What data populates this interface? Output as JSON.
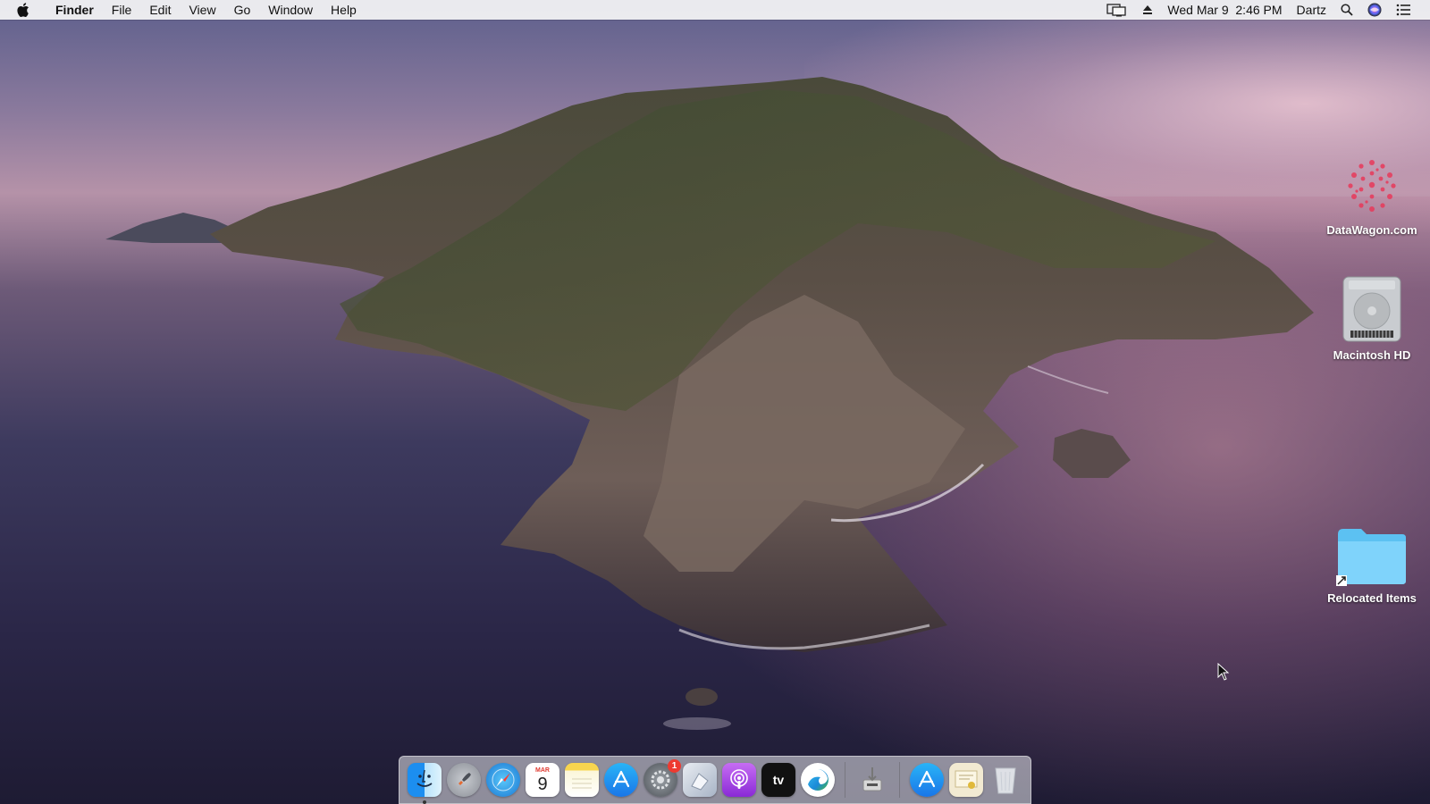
{
  "menubar": {
    "app_name": "Finder",
    "menus": [
      "File",
      "Edit",
      "View",
      "Go",
      "Window",
      "Help"
    ],
    "datetime": "Wed Mar 9  2:46 PM",
    "user": "Dartz",
    "status_icons": [
      "display-mirroring-icon",
      "eject-icon",
      "spotlight-icon",
      "siri-icon",
      "notification-center-icon"
    ]
  },
  "desktop": {
    "icons": [
      {
        "label": "DataWagon.com",
        "icon": "datawagon-logo-icon"
      },
      {
        "label": "Macintosh HD",
        "icon": "hard-drive-icon"
      },
      {
        "label": "Relocated Items",
        "icon": "folder-alias-icon"
      }
    ]
  },
  "dock": {
    "apps": [
      {
        "name": "finder-icon",
        "running": true
      },
      {
        "name": "launchpad-icon"
      },
      {
        "name": "safari-icon"
      },
      {
        "name": "calendar-icon",
        "month": "MAR",
        "day": "9"
      },
      {
        "name": "notes-icon"
      },
      {
        "name": "app-store-icon"
      },
      {
        "name": "system-preferences-icon",
        "badge": "1"
      },
      {
        "name": "preview-icon"
      },
      {
        "name": "podcasts-icon"
      },
      {
        "name": "apple-tv-icon",
        "text": "tv"
      },
      {
        "name": "edge-icon"
      },
      {
        "name": "installer-icon"
      },
      {
        "name": "app-store-downloads-icon"
      },
      {
        "name": "certificate-icon"
      },
      {
        "name": "trash-icon"
      }
    ]
  },
  "colors": {
    "folder_blue": "#5cc1f2",
    "badge_red": "#ee3a30",
    "menubar_bg": "#f6f6f6"
  }
}
